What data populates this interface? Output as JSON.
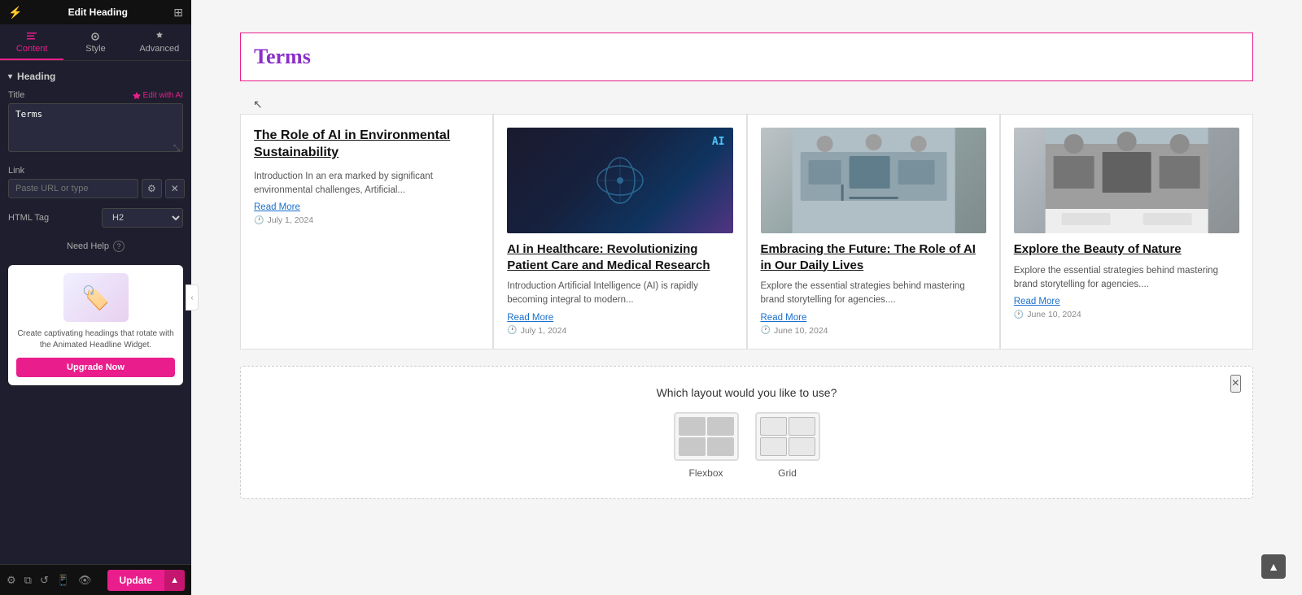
{
  "panel": {
    "title": "Edit Heading",
    "tabs": [
      {
        "label": "Content",
        "active": true
      },
      {
        "label": "Style",
        "active": false
      },
      {
        "label": "Advanced",
        "active": false
      }
    ],
    "section_heading": "Heading",
    "title_field_label": "Title",
    "edit_ai_label": "Edit with AI",
    "title_value": "Terms",
    "link_field_label": "Link",
    "link_placeholder": "Paste URL or type",
    "html_tag_label": "HTML Tag",
    "html_tag_value": "H2",
    "need_help_label": "Need Help",
    "pro_widget_text": "Create captivating headings that rotate with the Animated Headline Widget.",
    "upgrade_btn_label": "Upgrade Now",
    "update_btn_label": "Update"
  },
  "heading": {
    "text": "Terms"
  },
  "posts": [
    {
      "id": 1,
      "title": "The Role of AI in Environmental Sustainability",
      "excerpt": "Introduction In an era marked by significant environmental challenges, Artificial...",
      "read_more": "Read More",
      "date": "July 1, 2024",
      "has_image": false
    },
    {
      "id": 2,
      "title": "AI in Healthcare: Revolutionizing Patient Care and Medical Research",
      "excerpt": "Introduction Artificial Intelligence (AI) is rapidly becoming integral to modern...",
      "read_more": "Read More",
      "date": "July 1, 2024",
      "has_image": true,
      "image_type": "ai"
    },
    {
      "id": 3,
      "title": "Embracing the Future: The Role of AI in Our Daily Lives",
      "excerpt": "Explore the essential strategies behind mastering brand storytelling for agencies....",
      "read_more": "Read More",
      "date": "June 10, 2024",
      "has_image": true,
      "image_type": "office1"
    },
    {
      "id": 4,
      "title": "Explore the Beauty of Nature",
      "excerpt": "Explore the essential strategies behind mastering brand storytelling for agencies....",
      "read_more": "Read More",
      "date": "June 10, 2024",
      "has_image": true,
      "image_type": "office2"
    }
  ],
  "layout_modal": {
    "title": "Which layout would you like to use?",
    "close_icon": "×",
    "options": [
      {
        "label": "Flexbox",
        "type": "flexbox"
      },
      {
        "label": "Grid",
        "type": "grid"
      }
    ]
  },
  "scroll_top_icon": "▲",
  "cursor_symbol": "↖"
}
